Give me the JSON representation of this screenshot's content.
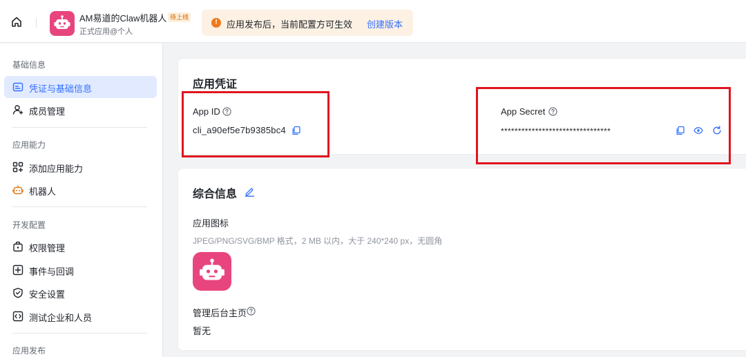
{
  "header": {
    "app_name": "AM易道的Claw机器人",
    "status_badge": "待上线",
    "app_subtitle": "正式应用@个人",
    "notice_text": "应用发布后，当前配置方可生效",
    "notice_link": "创建版本",
    "home_icon": "home-icon",
    "notice_icon": "warning-icon"
  },
  "sidebar": {
    "sections": [
      {
        "title": "基础信息",
        "items": [
          {
            "label": "凭证与基础信息",
            "icon": "credential-icon",
            "active": true
          },
          {
            "label": "成员管理",
            "icon": "member-icon",
            "active": false
          }
        ]
      },
      {
        "title": "应用能力",
        "items": [
          {
            "label": "添加应用能力",
            "icon": "add-capability-icon",
            "active": false
          },
          {
            "label": "机器人",
            "icon": "bot-icon",
            "active": false
          }
        ]
      },
      {
        "title": "开发配置",
        "items": [
          {
            "label": "权限管理",
            "icon": "permission-icon",
            "active": false
          },
          {
            "label": "事件与回调",
            "icon": "event-icon",
            "active": false
          },
          {
            "label": "安全设置",
            "icon": "shield-icon",
            "active": false
          },
          {
            "label": "测试企业和人员",
            "icon": "test-icon",
            "active": false
          }
        ]
      },
      {
        "title": "应用发布",
        "items": []
      }
    ]
  },
  "credentials": {
    "title": "应用凭证",
    "app_id_label": "App ID",
    "app_id_value": "cli_a90ef5e7b9385bc4",
    "app_secret_label": "App Secret",
    "app_secret_value": "********************************"
  },
  "general": {
    "title": "综合信息",
    "icon_label": "应用图标",
    "icon_hint": "JPEG/PNG/SVG/BMP 格式，2 MB 以内，大于 240*240 px，无圆角",
    "admin_home_label": "管理后台主页",
    "admin_home_value": "暂无"
  },
  "colors": {
    "accent": "#3370ff",
    "app_icon": "#e8457f",
    "highlight_box": "#e0141e",
    "notice_bg": "#fdf1e4"
  }
}
